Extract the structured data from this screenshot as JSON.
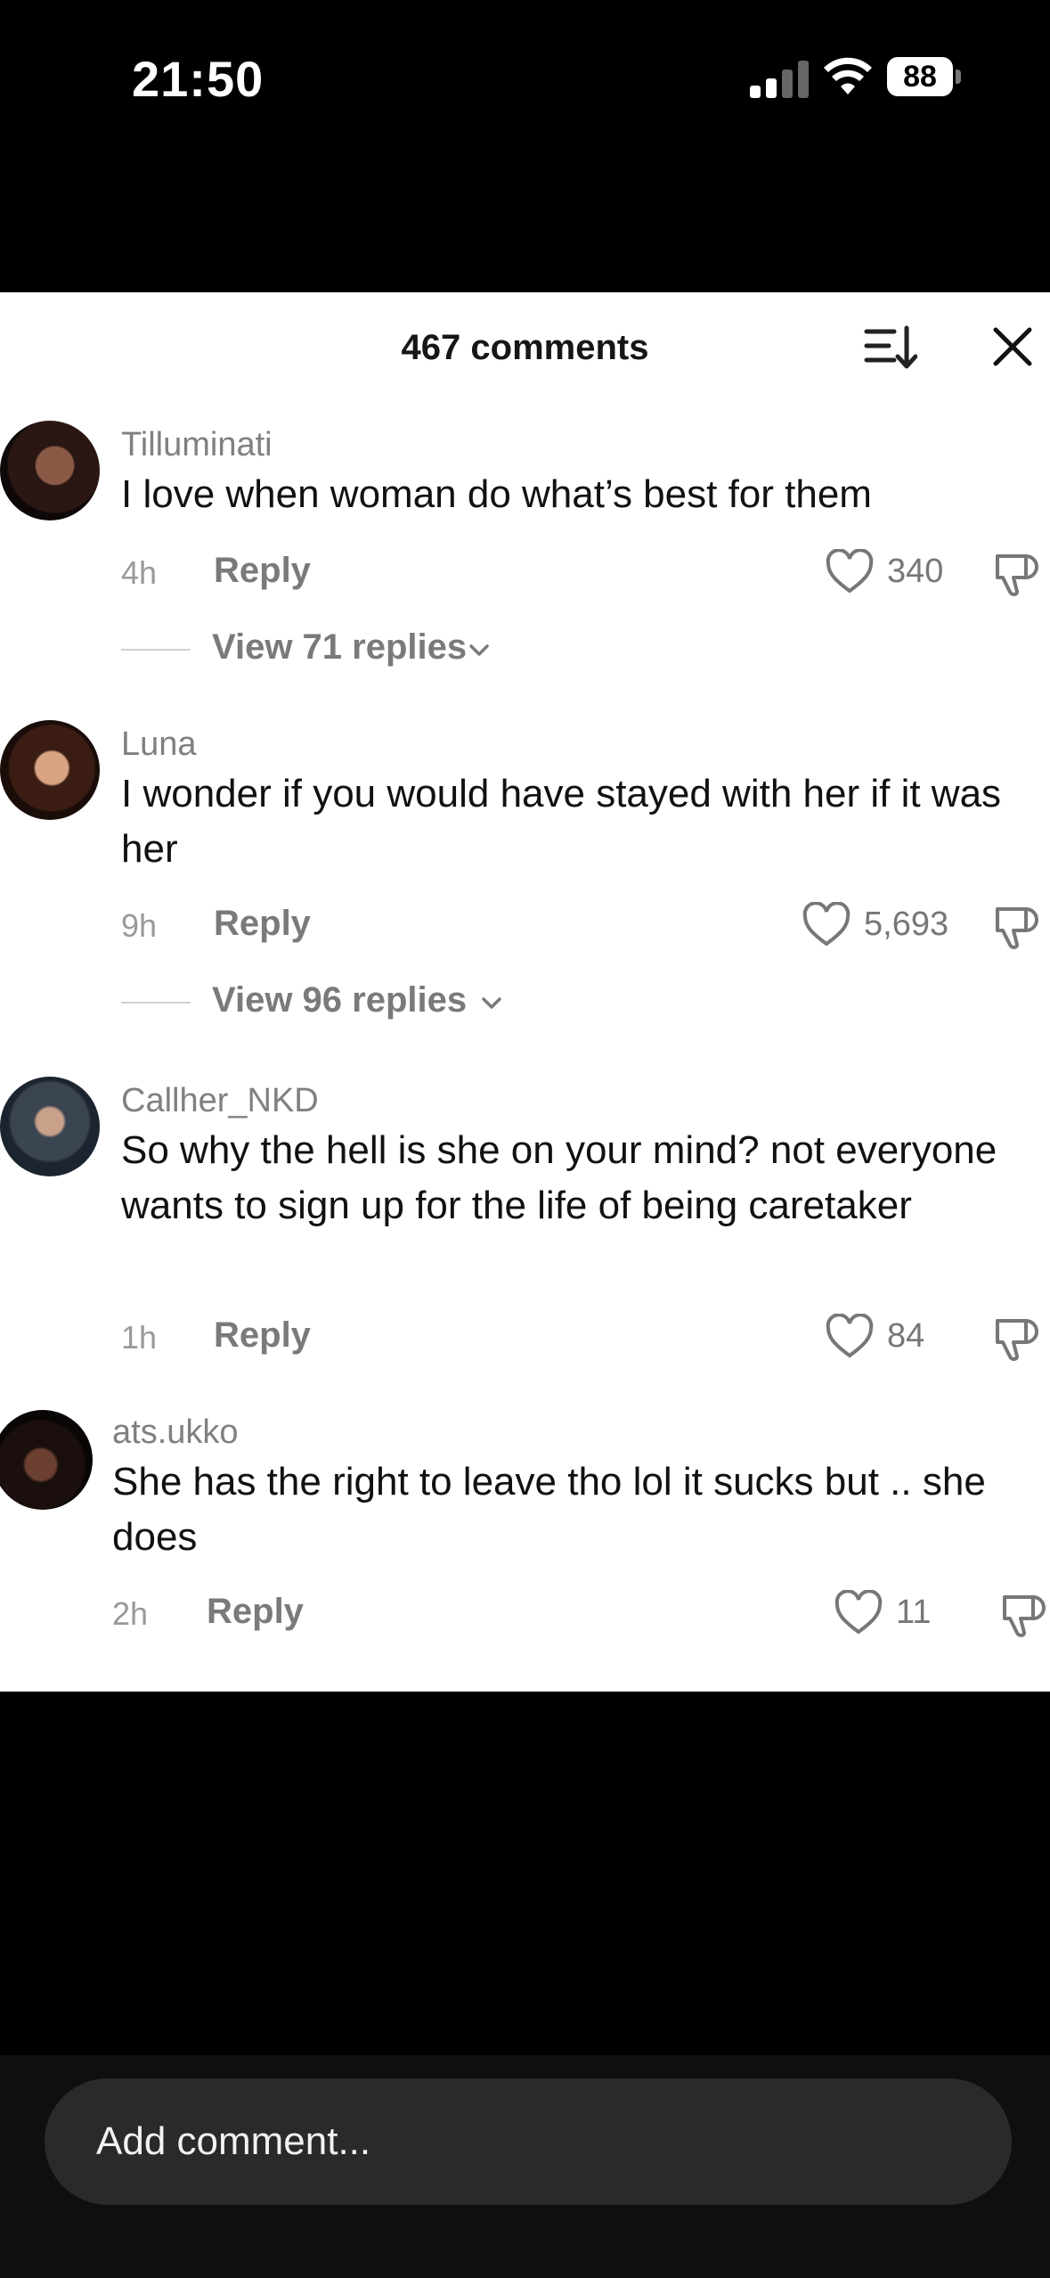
{
  "status_bar": {
    "time": "21:50",
    "battery": "88",
    "icons": [
      "signal-icon",
      "wifi-icon",
      "battery-icon"
    ]
  },
  "header": {
    "title": "467 comments",
    "icons": [
      "sort-icon",
      "close-icon"
    ]
  },
  "comments": [
    {
      "username": "Tilluminati",
      "text": "I love when woman do what’s best for them",
      "time": "4h",
      "reply_label": "Reply",
      "likes": "340",
      "view_replies": "View 71 replies"
    },
    {
      "username": "Luna",
      "text": "I wonder if you would have stayed with her if it was her",
      "time": "9h",
      "reply_label": "Reply",
      "likes": "5,693",
      "view_replies": "View 96 replies"
    },
    {
      "username": "Callher_NKD",
      "text": "So why the hell is she on your mind? not everyone wants to sign up for the life of being caretaker",
      "time": "1h",
      "reply_label": "Reply",
      "likes": "84"
    },
    {
      "username": "ats.ukko",
      "text": "She has the right to leave tho lol it sucks but .. she does",
      "time": "2h",
      "reply_label": "Reply",
      "likes": "11"
    }
  ],
  "composer": {
    "placeholder": "Add comment..."
  },
  "colors": {
    "sheet_background": "#ffffff",
    "screen_background": "#000000",
    "input_background": "#2a2a2c",
    "muted_text": "#7a7a7a"
  }
}
